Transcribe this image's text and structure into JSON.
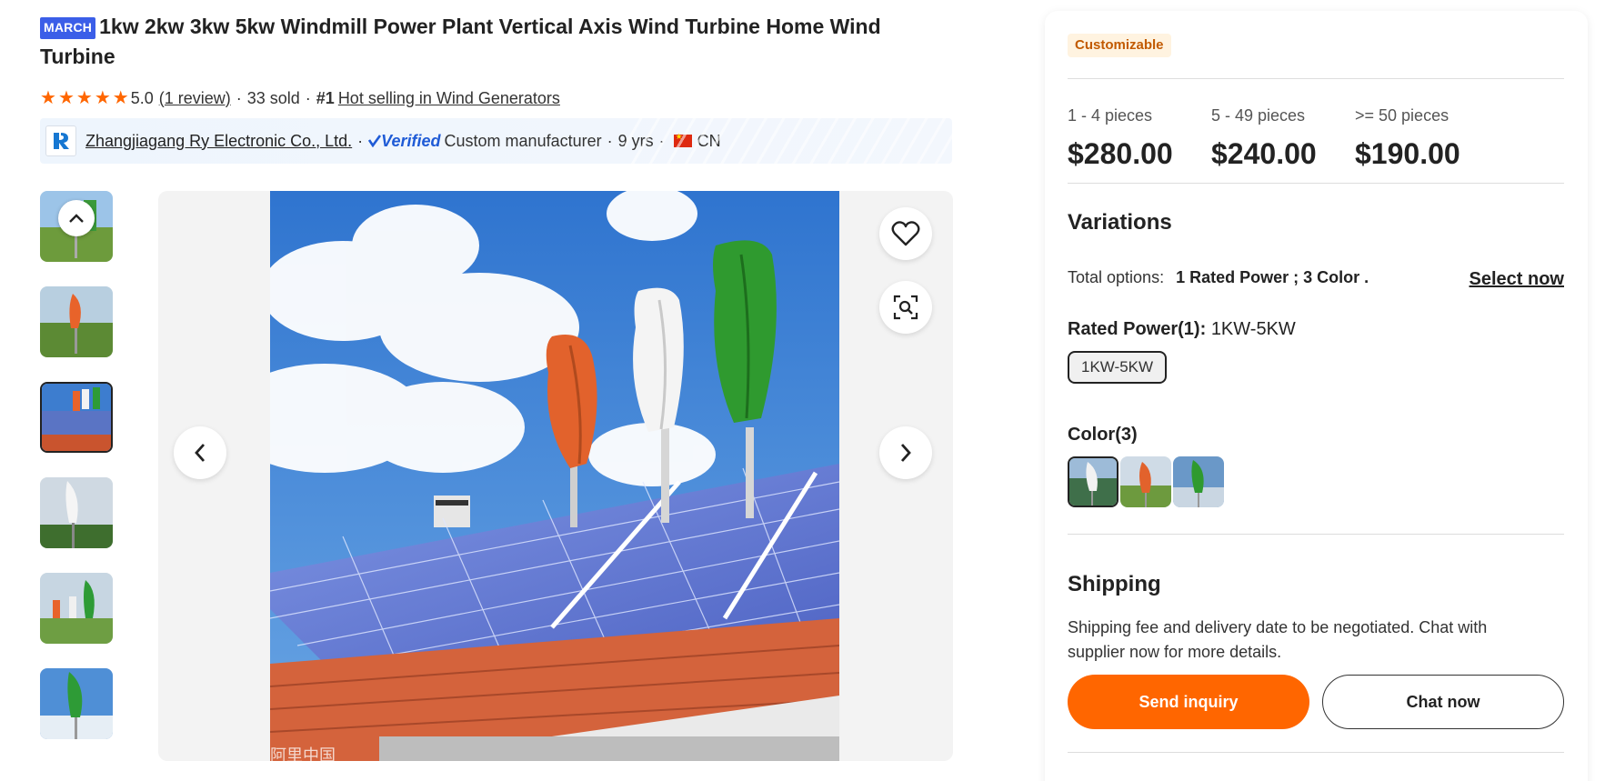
{
  "product": {
    "badge": "MARCH",
    "title": "1kw 2kw 3kw 5kw Windmill Power Plant Vertical Axis Wind Turbine Home Wind Turbine",
    "rating": "5.0",
    "review_link": "(1 review)",
    "sold": "33 sold",
    "rank_prefix": "#1",
    "rank_link": "Hot selling in Wind Generators",
    "stars": 5
  },
  "supplier": {
    "name": "Zhangjiagang Ry Electronic Co., Ltd.",
    "verified_label": "Verified",
    "type": "Custom manufacturer",
    "years": "9 yrs",
    "country": "CN"
  },
  "gallery": {
    "thumbnail_count": 6,
    "selected_index": 2,
    "watermark": "阿里中国"
  },
  "panel": {
    "tag": "Customizable",
    "price_tiers": [
      {
        "qty": "1 - 4 pieces",
        "price": "$280.00"
      },
      {
        "qty": "5 - 49 pieces",
        "price": "$240.00"
      },
      {
        "qty": ">= 50 pieces",
        "price": "$190.00"
      }
    ],
    "variations_title": "Variations",
    "total_options_label": "Total options:",
    "total_options_value": "1 Rated Power ; 3 Color .",
    "select_now": "Select now",
    "rated_power_label": "Rated Power(1):",
    "rated_power_value": "1KW-5KW",
    "rated_power_chip": "1KW-5KW",
    "color_label": "Color(3)",
    "shipping_title": "Shipping",
    "shipping_text": "Shipping fee and delivery date to be negotiated. Chat with supplier now for more details.",
    "send_inquiry": "Send inquiry",
    "chat_now": "Chat now"
  },
  "colors": {
    "accent": "#ff6600",
    "verified": "#1f5bd6",
    "march_badge": "#3b5ee8"
  }
}
